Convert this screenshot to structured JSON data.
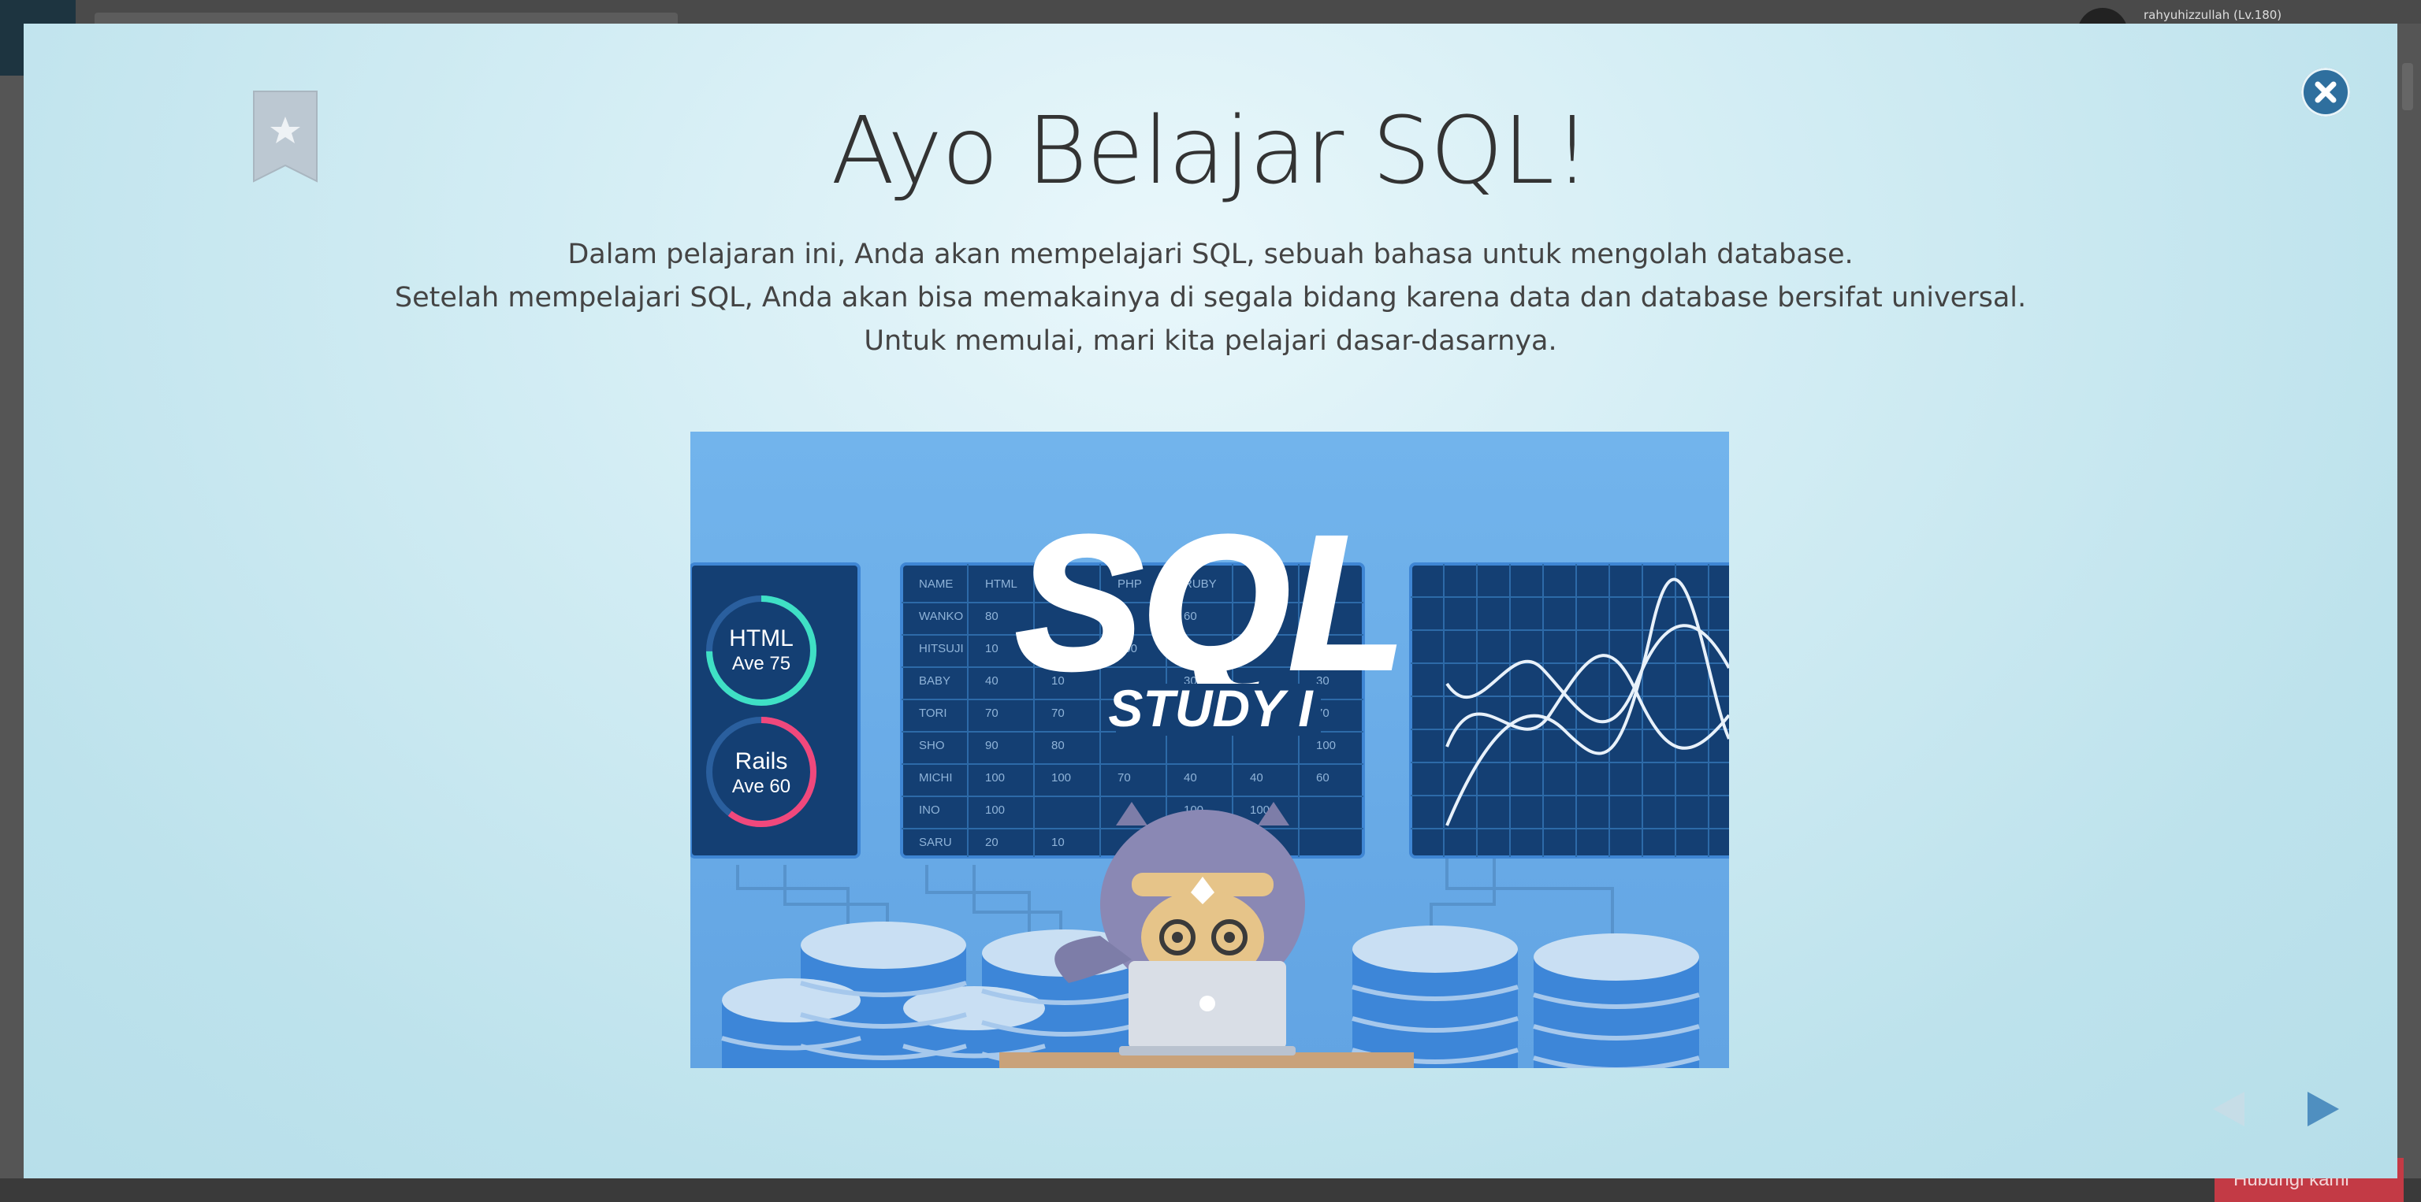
{
  "background": {
    "user_text": "rahyuhizzullah (Lv.180)",
    "bottom_button_label": "Hubungi kami"
  },
  "modal": {
    "title": "Ayo Belajar SQL!",
    "description": [
      "Dalam pelajaran ini, Anda akan mempelajari SQL, sebuah bahasa untuk mengolah database.",
      "Setelah mempelajari SQL, Anda akan bisa memakainya di segala bidang karena data dan database bersifat universal.",
      "Untuk memulai, mari kita pelajari dasar-dasarnya."
    ],
    "illustration": {
      "logo_text": "SQL",
      "subtitle": "STUDY I",
      "gauges": [
        {
          "name": "HTML",
          "sub": "Ave 75",
          "color": "#3fe0c5"
        },
        {
          "name": "Rails",
          "sub": "Ave 60",
          "color": "#f0487c"
        }
      ],
      "table": {
        "headers": [
          "NAME",
          "HTML",
          "",
          "PHP",
          "RUBY",
          "",
          ""
        ],
        "rows": [
          [
            "WANKO",
            "80",
            "",
            "",
            "60",
            "",
            ""
          ],
          [
            "HITSUJI",
            "10",
            "",
            "100",
            "",
            "",
            ""
          ],
          [
            "BABY",
            "40",
            "10",
            "",
            "30",
            "",
            "30"
          ],
          [
            "TORI",
            "70",
            "70",
            "",
            "",
            "",
            "70"
          ],
          [
            "SHO",
            "90",
            "80",
            "",
            "",
            "",
            "100"
          ],
          [
            "MICHI",
            "100",
            "100",
            "70",
            "40",
            "40",
            "60"
          ],
          [
            "INO",
            "100",
            "",
            "",
            "100",
            "100",
            ""
          ],
          [
            "SARU",
            "20",
            "10",
            "",
            "",
            "",
            ""
          ]
        ]
      }
    }
  },
  "colors": {
    "close_bg": "#2f6f9e",
    "nav_active": "#4f8fc0",
    "nav_disabled": "#c6dde7",
    "bookmark": "#b9c6d0"
  }
}
